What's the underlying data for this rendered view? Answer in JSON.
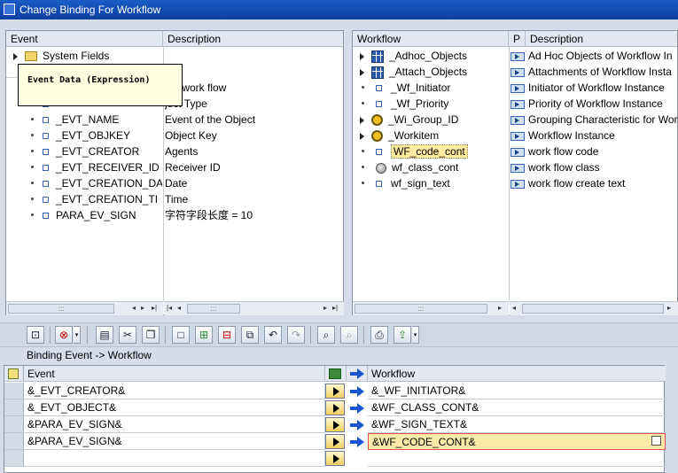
{
  "window": {
    "title": "Change Binding For Workflow"
  },
  "event_panel": {
    "headers": {
      "event": "Event",
      "description": "Description"
    },
    "system_fields": "System Fields",
    "tooltip": "Event Data (Expression)",
    "rows": [
      {
        "name": "",
        "description": "est work flow"
      },
      {
        "name": "",
        "description": "ject Type"
      },
      {
        "name": "_EVT_NAME",
        "description": "Event of the Object"
      },
      {
        "name": "_EVT_OBJKEY",
        "description": "Object Key"
      },
      {
        "name": "_EVT_CREATOR",
        "description": "Agents"
      },
      {
        "name": "_EVT_RECEIVER_ID",
        "description": "Receiver ID"
      },
      {
        "name": "_EVT_CREATION_DA",
        "description": "Date"
      },
      {
        "name": "_EVT_CREATION_TI",
        "description": "Time"
      },
      {
        "name": "PARA_EV_SIGN",
        "description": "字符字段长度 = 10"
      }
    ],
    "scroll_thumb": ":::"
  },
  "workflow_panel": {
    "headers": {
      "workflow": "Workflow",
      "p": "P",
      "description": "Description"
    },
    "rows": [
      {
        "name": "_Adhoc_Objects",
        "description": "Ad Hoc Objects of Workflow In",
        "icon": "grid-icon",
        "expand": "collapsed"
      },
      {
        "name": "_Attach_Objects",
        "description": "Attachments of Workflow Insta",
        "icon": "grid-icon",
        "expand": "collapsed"
      },
      {
        "name": "_Wf_Initiator",
        "description": "Initiator of Workflow Instance",
        "icon": "square-icon",
        "expand": "leaf"
      },
      {
        "name": "_Wf_Priority",
        "description": "Priority of Workflow Instance",
        "icon": "square-icon",
        "expand": "leaf"
      },
      {
        "name": "_Wi_Group_ID",
        "description": "Grouping Characteristic for Wor",
        "icon": "gear-icon",
        "expand": "collapsed"
      },
      {
        "name": "_Workitem",
        "description": "Workflow Instance",
        "icon": "gear-icon",
        "expand": "collapsed"
      },
      {
        "name": "WF_code_cont",
        "description": "work flow code",
        "icon": "square-icon",
        "expand": "leaf"
      },
      {
        "name": "wf_class_cont",
        "description": "work flow class",
        "icon": "ball-icon",
        "expand": "leaf"
      },
      {
        "name": "wf_sign_text",
        "description": "work flow create text",
        "icon": "square-icon",
        "expand": "leaf"
      }
    ],
    "scroll_thumb": ":::"
  },
  "binding": {
    "caption": "Binding Event  -> Workflow",
    "headers": {
      "event": "Event",
      "workflow": "Workflow"
    },
    "rows": [
      {
        "event": "&_EVT_CREATOR&",
        "workflow": "&_WF_INITIATOR&"
      },
      {
        "event": "&_EVT_OBJECT&",
        "workflow": "&WF_CLASS_CONT&"
      },
      {
        "event": "&PARA_EV_SIGN&",
        "workflow": "&WF_SIGN_TEXT&"
      },
      {
        "event": "&PARA_EV_SIGN&",
        "workflow": "&WF_CODE_CONT&"
      },
      {
        "event": "",
        "workflow": ""
      }
    ]
  }
}
